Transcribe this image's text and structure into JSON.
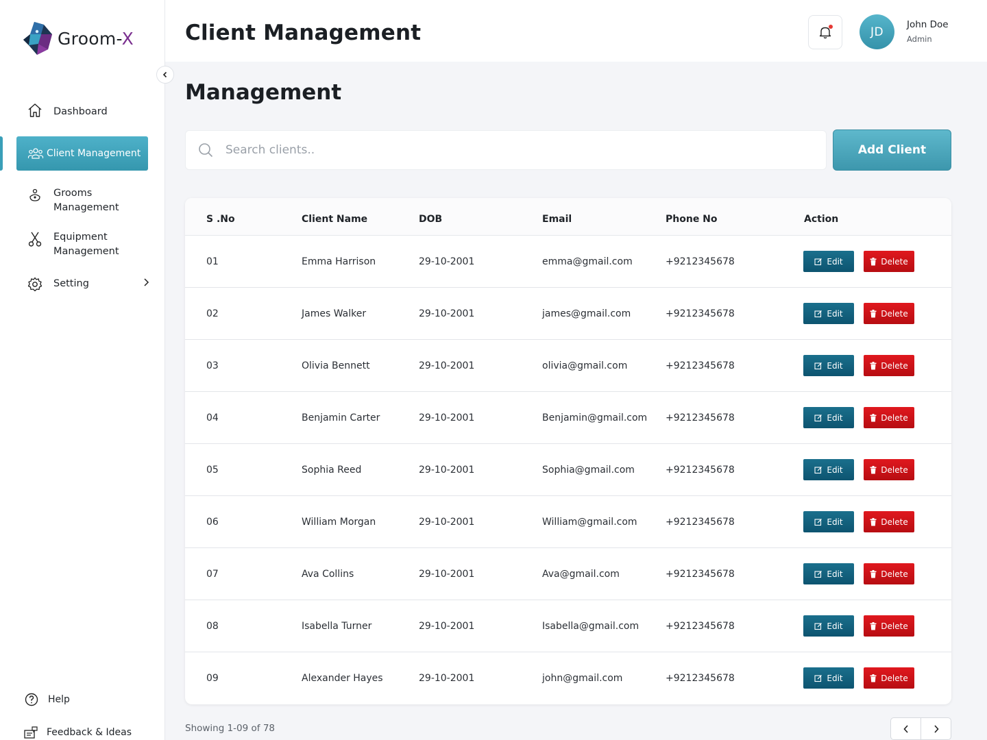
{
  "app": {
    "logo_text": "Groom-",
    "logo_accent": "X"
  },
  "sidebar": {
    "items": [
      {
        "label": "Dashboard",
        "icon": "home-icon"
      },
      {
        "label": "Client Management",
        "icon": "users-icon",
        "active": true
      },
      {
        "label": "Grooms Management",
        "icon": "groom-icon"
      },
      {
        "label": "Equipment Management",
        "icon": "scissors-icon"
      },
      {
        "label": "Setting",
        "icon": "gear-icon"
      }
    ],
    "footer": [
      {
        "label": "Help",
        "icon": "help-icon"
      },
      {
        "label": "Feedback & Ideas",
        "icon": "feedback-icon"
      }
    ]
  },
  "header": {
    "title": "Client Management",
    "user_initials": "JD",
    "user_name": "John Doe",
    "user_role": "Admin"
  },
  "main": {
    "section_title": "Management",
    "search_placeholder": "Search clients..",
    "add_button": "Add Client",
    "columns": [
      "S .No",
      "Client Name",
      "DOB",
      "Email",
      "Phone No",
      "Action"
    ],
    "edit_label": "Edit",
    "delete_label": "Delete",
    "rows": [
      {
        "sno": "01",
        "name": "Emma Harrison",
        "dob": "29-10-2001",
        "email": "emma@gmail.com",
        "phone": "+9212345678"
      },
      {
        "sno": "02",
        "name": "James Walker",
        "dob": "29-10-2001",
        "email": "james@gmail.com",
        "phone": "+9212345678"
      },
      {
        "sno": "03",
        "name": "Olivia Bennett",
        "dob": "29-10-2001",
        "email": "olivia@gmail.com",
        "phone": "+9212345678"
      },
      {
        "sno": "04",
        "name": "Benjamin Carter",
        "dob": "29-10-2001",
        "email": "Benjamin@gmail.com",
        "phone": "+9212345678"
      },
      {
        "sno": "05",
        "name": "Sophia Reed",
        "dob": "29-10-2001",
        "email": "Sophia@gmail.com",
        "phone": "+9212345678"
      },
      {
        "sno": "06",
        "name": "William Morgan",
        "dob": "29-10-2001",
        "email": "William@gmail.com",
        "phone": "+9212345678"
      },
      {
        "sno": "07",
        "name": "Ava Collins",
        "dob": "29-10-2001",
        "email": "Ava@gmail.com",
        "phone": "+9212345678"
      },
      {
        "sno": "08",
        "name": "Isabella Turner",
        "dob": "29-10-2001",
        "email": "Isabella@gmail.com",
        "phone": "+9212345678"
      },
      {
        "sno": "09",
        "name": "Alexander Hayes",
        "dob": "29-10-2001",
        "email": "john@gmail.com",
        "phone": "+9212345678"
      }
    ],
    "showing_text": "Showing 1-09 of 78"
  },
  "colors": {
    "accent": "#3a9fb8",
    "edit": "#0d5470",
    "delete": "#d0141a",
    "notification_dot": "#e53935"
  }
}
